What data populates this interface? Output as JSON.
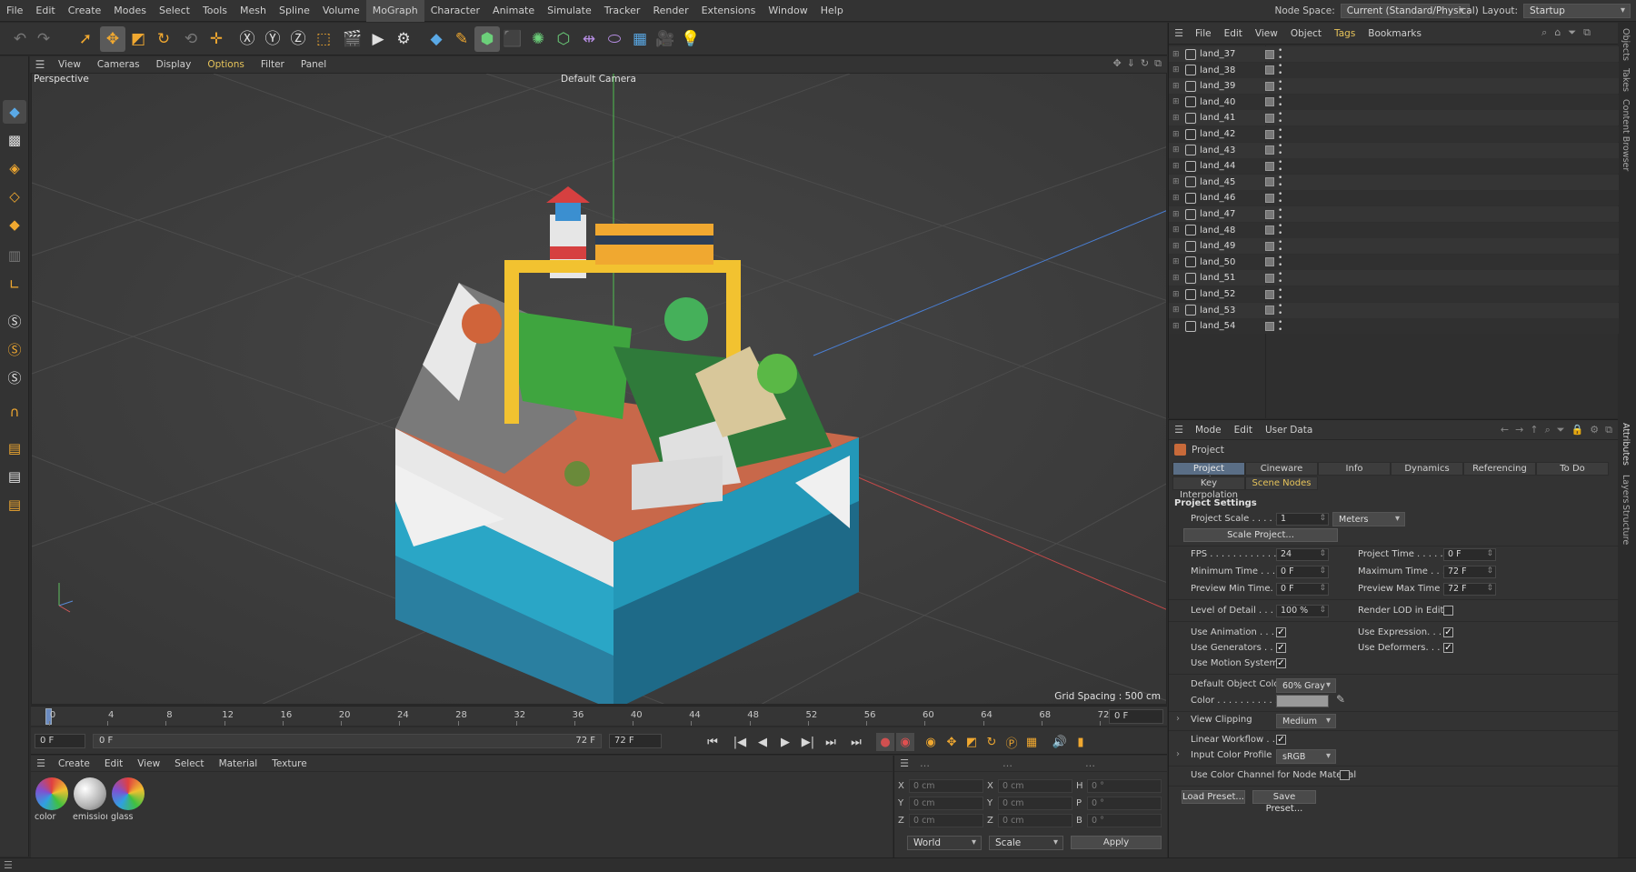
{
  "menubar": {
    "items": [
      "File",
      "Edit",
      "Create",
      "Modes",
      "Select",
      "Tools",
      "Mesh",
      "Spline",
      "Volume",
      "MoGraph",
      "Character",
      "Animate",
      "Simulate",
      "Tracker",
      "Render",
      "Extensions",
      "Window",
      "Help"
    ],
    "active_index": 9,
    "node_space_label": "Node Space:",
    "node_space_value": "Current (Standard/Physical)",
    "layout_label": "Layout:",
    "layout_value": "Startup"
  },
  "toolbar": {
    "tools": [
      {
        "name": "undo-icon",
        "glyph": "↶",
        "color": "#777777"
      },
      {
        "name": "redo-icon",
        "glyph": "↷",
        "color": "#777777"
      },
      {
        "name": "live-selection-icon",
        "glyph": "➚",
        "color": "#f0a830"
      },
      {
        "name": "move-icon",
        "glyph": "✥",
        "color": "#f0a830"
      },
      {
        "name": "scale-icon",
        "glyph": "◩",
        "color": "#f0a830"
      },
      {
        "name": "rotate-icon",
        "glyph": "↻",
        "color": "#f0a830"
      },
      {
        "name": "recent-tools-icon",
        "glyph": "⟲",
        "color": "#777777"
      },
      {
        "name": "add-icon",
        "glyph": "✛",
        "color": "#f0a830"
      },
      {
        "name": "x-axis-icon",
        "glyph": "Ⓧ",
        "color": "#e0e0e0"
      },
      {
        "name": "y-axis-icon",
        "glyph": "Ⓨ",
        "color": "#e0e0e0"
      },
      {
        "name": "z-axis-icon",
        "glyph": "Ⓩ",
        "color": "#e0e0e0"
      },
      {
        "name": "coordinate-system-icon",
        "glyph": "⬚",
        "color": "#f0a830"
      },
      {
        "name": "render-view-icon",
        "glyph": "🎬",
        "color": "#e0e0e0"
      },
      {
        "name": "render-picture-viewer-icon",
        "glyph": "▶",
        "color": "#e0e0e0"
      },
      {
        "name": "render-settings-icon",
        "glyph": "⚙",
        "color": "#e0e0e0"
      },
      {
        "name": "cube-icon",
        "glyph": "◆",
        "color": "#5aa9e6"
      },
      {
        "name": "pen-icon",
        "glyph": "✎",
        "color": "#f0a830"
      },
      {
        "name": "subdivision-icon",
        "glyph": "⬢",
        "color": "#6cd07a"
      },
      {
        "name": "extrude-icon",
        "glyph": "⬛",
        "color": "#6cd07a"
      },
      {
        "name": "cloner-icon",
        "glyph": "✺",
        "color": "#6cd07a"
      },
      {
        "name": "mograph-icon",
        "glyph": "⬡",
        "color": "#6cd07a"
      },
      {
        "name": "deformer-icon",
        "glyph": "⇹",
        "color": "#b48ce0"
      },
      {
        "name": "field-icon",
        "glyph": "⬭",
        "color": "#b48ce0"
      },
      {
        "name": "floor-icon",
        "glyph": "▦",
        "color": "#5aa9e6"
      },
      {
        "name": "camera-icon",
        "glyph": "🎥",
        "color": "#e0e0e0"
      },
      {
        "name": "light-icon",
        "glyph": "💡",
        "color": "#e0e0e0"
      }
    ]
  },
  "viewport": {
    "menu": [
      "View",
      "Cameras",
      "Display",
      "Options",
      "Filter",
      "Panel"
    ],
    "highlight_index": 3,
    "perspective_label": "Perspective",
    "camera_label": "Default Camera",
    "grid_spacing": "Grid Spacing : 500 cm"
  },
  "timeline": {
    "ticks": [
      "0",
      "4",
      "8",
      "12",
      "16",
      "20",
      "24",
      "28",
      "32",
      "36",
      "40",
      "44",
      "48",
      "52",
      "56",
      "60",
      "64",
      "68",
      "72"
    ],
    "current_frame": "0 F"
  },
  "playbar": {
    "start": "0 F",
    "range_start": "0 F",
    "range_end": "72 F",
    "end": "72 F"
  },
  "materials": {
    "menu": [
      "Create",
      "Edit",
      "View",
      "Select",
      "Material",
      "Texture"
    ],
    "items": [
      {
        "name": "color",
        "type": "rainbow"
      },
      {
        "name": "emission",
        "type": "white"
      },
      {
        "name": "glass",
        "type": "rainbow"
      }
    ]
  },
  "coordinates": {
    "rows": [
      {
        "a": "X",
        "av": "0 cm",
        "b": "X",
        "bv": "0 cm",
        "c": "H",
        "cv": "0 °"
      },
      {
        "a": "Y",
        "av": "0 cm",
        "b": "Y",
        "bv": "0 cm",
        "c": "P",
        "cv": "0 °"
      },
      {
        "a": "Z",
        "av": "0 cm",
        "b": "Z",
        "bv": "0 cm",
        "c": "B",
        "cv": "0 °"
      }
    ],
    "world": "World",
    "scale": "Scale",
    "apply": "Apply"
  },
  "objects": {
    "menu": [
      "File",
      "Edit",
      "View",
      "Object",
      "Tags",
      "Bookmarks"
    ],
    "highlight_index": 4,
    "items": [
      "land_37",
      "land_38",
      "land_39",
      "land_40",
      "land_41",
      "land_42",
      "land_43",
      "land_44",
      "land_45",
      "land_46",
      "land_47",
      "land_48",
      "land_49",
      "land_50",
      "land_51",
      "land_52",
      "land_53",
      "land_54"
    ]
  },
  "attributes": {
    "menu": [
      "Mode",
      "Edit",
      "User Data"
    ],
    "object_label": "Project",
    "tabs": [
      "Project Settings",
      "Cineware",
      "Info",
      "Dynamics",
      "Referencing",
      "To Do"
    ],
    "tabs2": [
      "Key Interpolation",
      "Scene Nodes"
    ],
    "section_title": "Project Settings",
    "project_scale_label": "Project Scale . . . . . .",
    "project_scale_value": "1",
    "project_scale_unit": "Meters",
    "scale_project_btn": "Scale Project...",
    "fps_label": "FPS . . . . . . . . . . . . . . .",
    "fps_value": "24",
    "project_time_label": "Project Time . . . . . .",
    "project_time_value": "0 F",
    "min_time_label": "Minimum Time . . . .",
    "min_time_value": "0 F",
    "max_time_label": "Maximum Time . . .",
    "max_time_value": "72 F",
    "prev_min_label": "Preview Min Time. .",
    "prev_min_value": "0 F",
    "prev_max_label": "Preview Max Time . .",
    "prev_max_value": "72 F",
    "lod_label": "Level of Detail . . . .",
    "lod_value": "100 %",
    "render_lod_label": "Render LOD in Editor",
    "use_animation_label": "Use Animation . . . . .",
    "use_expression_label": "Use Expression. . . .",
    "use_generators_label": "Use Generators . . . .",
    "use_deformers_label": "Use Deformers. . . . .",
    "use_motion_label": "Use Motion System",
    "default_color_label": "Default Object Color",
    "default_color_value": "60% Gray",
    "color_label": "Color . . . . . . . . . . . .",
    "view_clipping_label": "View Clipping",
    "view_clipping_value": "Medium",
    "linear_workflow_label": "Linear Workflow . . .",
    "input_profile_label": "Input Color Profile",
    "input_profile_value": "sRGB",
    "node_material_label": "Use Color Channel for Node Material",
    "load_preset": "Load Preset...",
    "save_preset": "Save Preset..."
  },
  "side_tabs": [
    "Objects",
    "Takes",
    "Content Browser",
    "Attributes",
    "Layers",
    "Structure"
  ]
}
